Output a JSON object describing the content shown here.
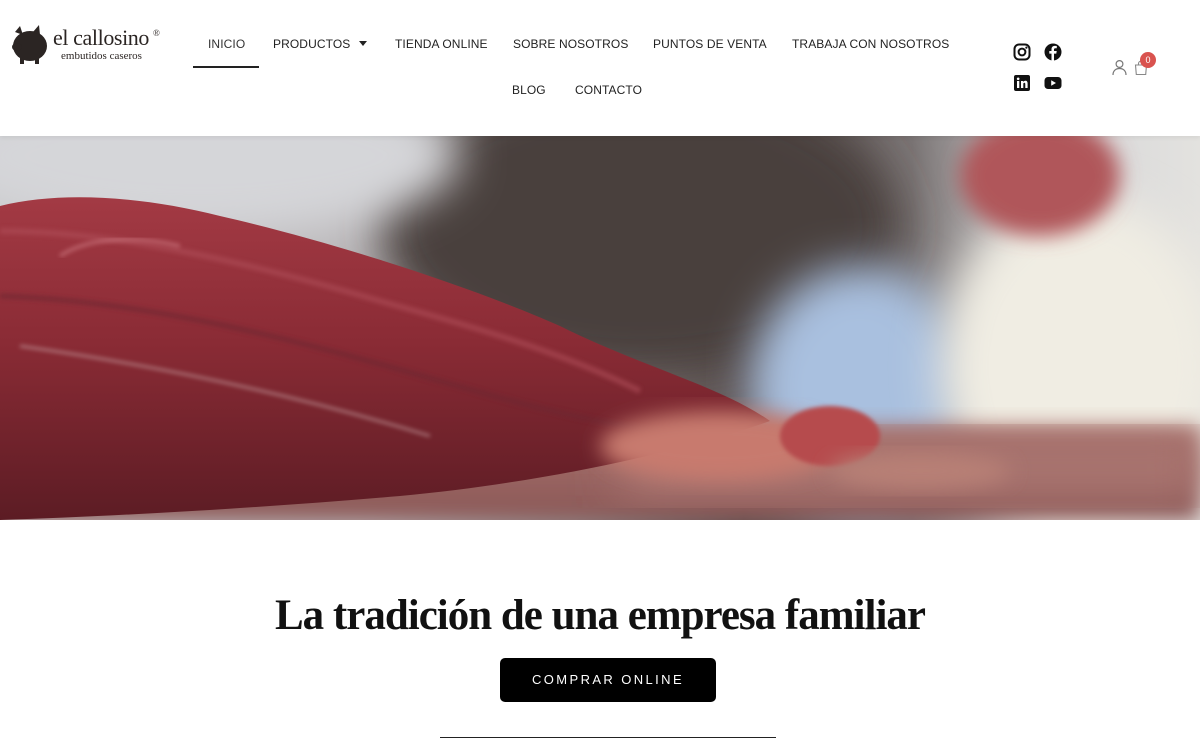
{
  "brand": {
    "name": "el callosino",
    "registered": "®",
    "tagline": "embutidos caseros"
  },
  "nav": {
    "items": [
      {
        "label": "INICIO",
        "active": true
      },
      {
        "label": "PRODUCTOS",
        "has_dropdown": true
      },
      {
        "label": "TIENDA ONLINE"
      },
      {
        "label": "SOBRE NOSOTROS"
      },
      {
        "label": "PUNTOS DE VENTA"
      },
      {
        "label": "TRABAJA CON NOSOTROS"
      },
      {
        "label": "BLOG"
      },
      {
        "label": "CONTACTO"
      }
    ]
  },
  "social": {
    "icons": [
      "instagram-icon",
      "facebook-icon",
      "linkedin-icon",
      "youtube-icon"
    ]
  },
  "account": {
    "user_icon": "user-icon",
    "cart_icon": "cart-icon",
    "cart_count": "0"
  },
  "hero": {
    "image": "close-up of raw red meat being cut on a board"
  },
  "main": {
    "headline": "La tradición de una empresa familiar",
    "cta_label": "COMPRAR ONLINE"
  },
  "colors": {
    "text": "#222222",
    "button_bg": "#000000",
    "button_text": "#ffffff",
    "badge": "#d9534f"
  }
}
